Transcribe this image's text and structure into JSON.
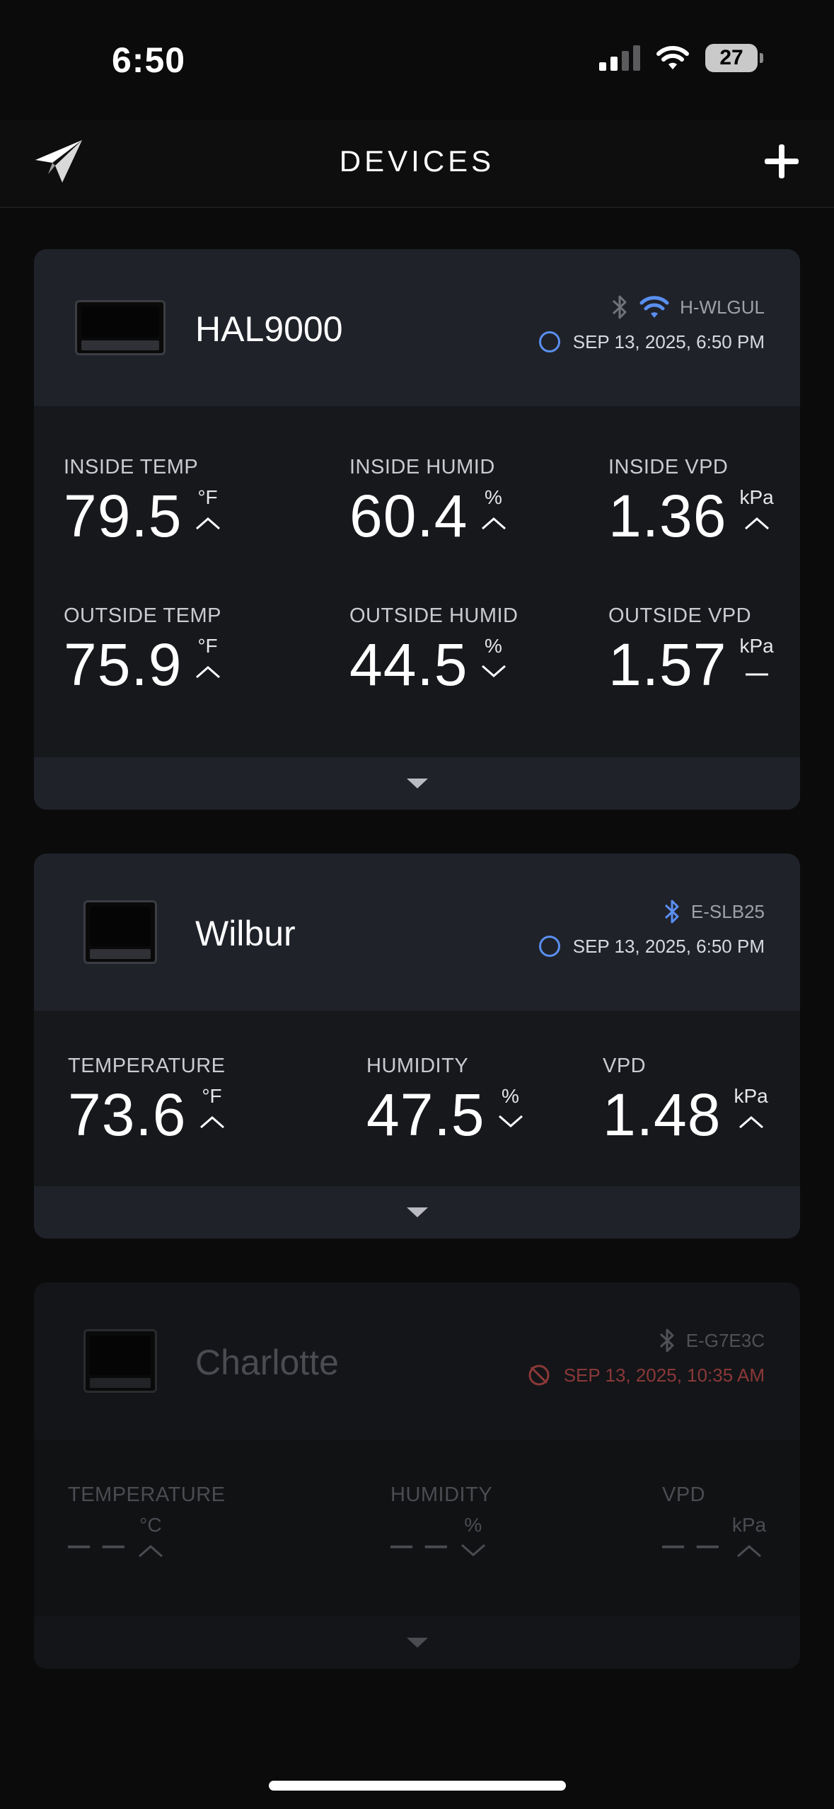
{
  "status_bar": {
    "time": "6:50",
    "battery": "27",
    "icons": [
      "cellular-signal-icon",
      "wifi-icon",
      "battery-icon"
    ]
  },
  "header": {
    "title": "DEVICES",
    "logo_icon": "paper-plane-logo-icon",
    "add_icon": "plus-icon"
  },
  "devices": [
    {
      "name": "HAL9000",
      "device_id": "H-WLGUL",
      "connections": [
        "bluetooth-icon",
        "wifi-icon"
      ],
      "timestamp": "SEP 13, 2025, 6:50 PM",
      "status_color": "#5a8ff0",
      "metrics": [
        {
          "label": "INSIDE TEMP",
          "value": "79.5",
          "unit": "°F",
          "trend": "up"
        },
        {
          "label": "INSIDE HUMID",
          "value": "60.4",
          "unit": "%",
          "trend": "up"
        },
        {
          "label": "INSIDE VPD",
          "value": "1.36",
          "unit": "kPa",
          "trend": "up"
        },
        {
          "label": "OUTSIDE TEMP",
          "value": "75.9",
          "unit": "°F",
          "trend": "up"
        },
        {
          "label": "OUTSIDE HUMID",
          "value": "44.5",
          "unit": "%",
          "trend": "down"
        },
        {
          "label": "OUTSIDE VPD",
          "value": "1.57",
          "unit": "kPa",
          "trend": "flat"
        }
      ]
    },
    {
      "name": "Wilbur",
      "device_id": "E-SLB25",
      "connections": [
        "bluetooth-icon"
      ],
      "timestamp": "SEP 13, 2025, 6:50 PM",
      "status_color": "#5a8ff0",
      "metrics": [
        {
          "label": "TEMPERATURE",
          "value": "73.6",
          "unit": "°F",
          "trend": "up"
        },
        {
          "label": "HUMIDITY",
          "value": "47.5",
          "unit": "%",
          "trend": "down"
        },
        {
          "label": "VPD",
          "value": "1.48",
          "unit": "kPa",
          "trend": "up"
        }
      ]
    },
    {
      "name": "Charlotte",
      "device_id": "E-G7E3C",
      "connections": [
        "bluetooth-icon"
      ],
      "timestamp": "SEP 13, 2025, 10:35 AM",
      "status_color": "#a83c3c",
      "offline": true,
      "metrics": [
        {
          "label": "TEMPERATURE",
          "value": "– –",
          "unit": "°C",
          "trend": "up"
        },
        {
          "label": "HUMIDITY",
          "value": "– –",
          "unit": "%",
          "trend": "down"
        },
        {
          "label": "VPD",
          "value": "– –",
          "unit": "kPa",
          "trend": "up"
        }
      ]
    }
  ]
}
